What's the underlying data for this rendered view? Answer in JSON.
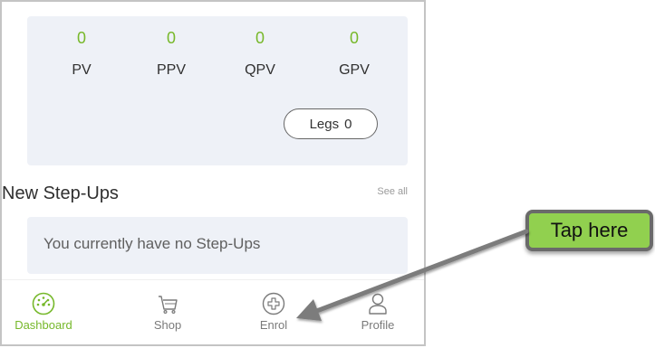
{
  "stats": {
    "pv": {
      "value": "0",
      "label": "PV"
    },
    "ppv": {
      "value": "0",
      "label": "PPV"
    },
    "qpv": {
      "value": "0",
      "label": "QPV"
    },
    "gpv": {
      "value": "0",
      "label": "GPV"
    }
  },
  "legs": {
    "label": "Legs",
    "value": "0"
  },
  "step_ups": {
    "title": "New Step-Ups",
    "see_all": "See all",
    "empty_message": "You currently have no Step-Ups"
  },
  "bottom_nav": {
    "dashboard": {
      "label": "Dashboard",
      "icon": "speedometer-icon"
    },
    "shop": {
      "label": "Shop",
      "icon": "cart-icon"
    },
    "enrol": {
      "label": "Enrol",
      "icon": "plus-circle-icon"
    },
    "profile": {
      "label": "Profile",
      "icon": "user-icon"
    }
  },
  "callout": {
    "text": "Tap here"
  },
  "colors": {
    "accent": "#76b82a",
    "card_bg": "#eef1f7",
    "callout_bg": "#91d04f",
    "callout_border": "#6a6a6a"
  }
}
